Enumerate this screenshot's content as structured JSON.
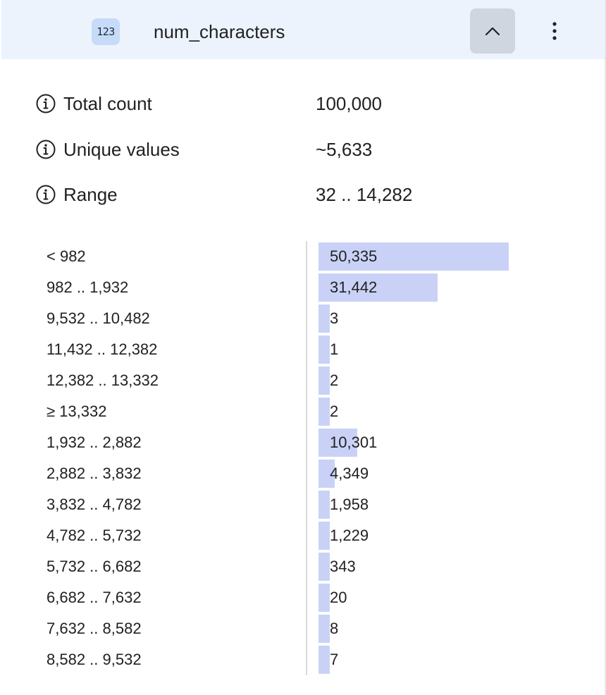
{
  "header": {
    "type_badge": "123",
    "field_name": "num_characters",
    "collapse_icon": "chevron-up-icon",
    "more_icon": "more-vertical-icon"
  },
  "stats": [
    {
      "label": "Total count",
      "value": "100,000",
      "icon": "info-icon"
    },
    {
      "label": "Unique values",
      "value": "~5,633",
      "icon": "info-icon"
    },
    {
      "label": "Range",
      "value": "32 .. 14,282",
      "icon": "info-icon"
    }
  ],
  "histogram": {
    "max_count": 50335,
    "bins": [
      {
        "label": "< 982",
        "count": 50335,
        "count_label": "50,335"
      },
      {
        "label": "982 .. 1,932",
        "count": 31442,
        "count_label": "31,442"
      },
      {
        "label": "9,532 .. 10,482",
        "count": 3,
        "count_label": "3"
      },
      {
        "label": "11,432 .. 12,382",
        "count": 1,
        "count_label": "1"
      },
      {
        "label": "12,382 .. 13,332",
        "count": 2,
        "count_label": "2"
      },
      {
        "label": "≥ 13,332",
        "count": 2,
        "count_label": "2"
      },
      {
        "label": "1,932 .. 2,882",
        "count": 10301,
        "count_label": "10,301"
      },
      {
        "label": "2,882 .. 3,832",
        "count": 4349,
        "count_label": "4,349"
      },
      {
        "label": "3,832 .. 4,782",
        "count": 1958,
        "count_label": "1,958"
      },
      {
        "label": "4,782 .. 5,732",
        "count": 1229,
        "count_label": "1,229"
      },
      {
        "label": "5,732 .. 6,682",
        "count": 343,
        "count_label": "343"
      },
      {
        "label": "6,682 .. 7,632",
        "count": 20,
        "count_label": "20"
      },
      {
        "label": "7,632 .. 8,582",
        "count": 8,
        "count_label": "8"
      },
      {
        "label": "8,582 .. 9,532",
        "count": 7,
        "count_label": "7"
      }
    ]
  },
  "colors": {
    "header_bg": "#edf3fd",
    "badge_bg": "#c6dbf8",
    "collapse_btn_bg": "#cfd6df",
    "bar": "#c9d2f6",
    "divider": "#d9d9d9"
  }
}
